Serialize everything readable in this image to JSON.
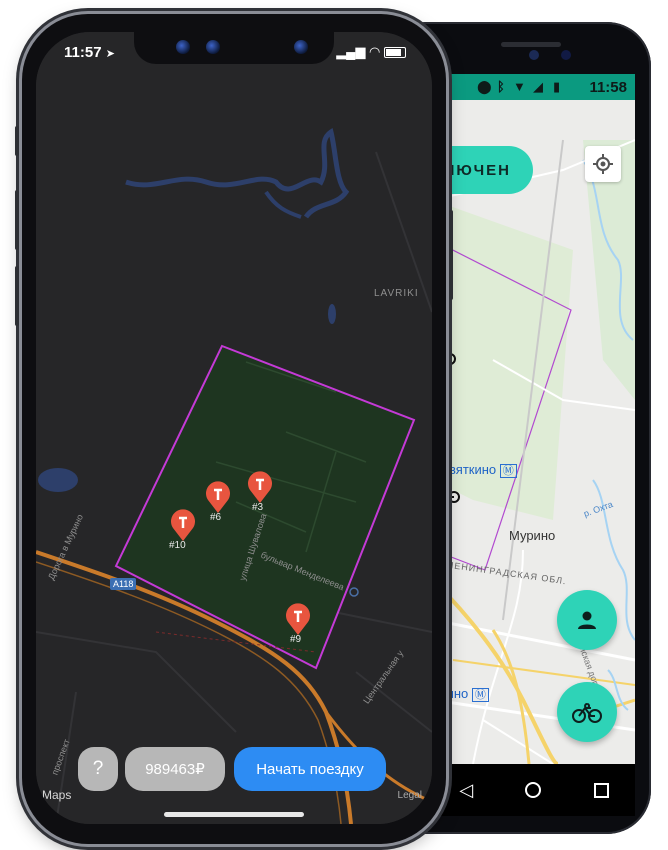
{
  "android": {
    "status": {
      "time": "11:58"
    },
    "status_pill": {
      "label": "КЛЮЧЕН"
    },
    "map_labels": {
      "devyatkino": "Девяткино",
      "murino": "Мурино",
      "murino_station": "урино",
      "leningradskaya": "ЛЕНИНГРАДСКАЯ ОБЛ.",
      "okhta": "р. Охта",
      "muriskaya": "Мурийская дор."
    },
    "fabs": [
      "person-icon",
      "bike-icon"
    ],
    "nav": [
      "back-icon",
      "home-icon",
      "recents-icon"
    ]
  },
  "iphone": {
    "status": {
      "time": "11:57"
    },
    "map_labels": {
      "lavriki": "LAVRIKI",
      "road_a118": "A118",
      "doroga": "Дорога в Мурино",
      "shuvalova": "улица Шувалова",
      "mendeleeva": "бульвар Менделеева",
      "centralnaya": "Центральная у",
      "prospekt": "проспект"
    },
    "pins": [
      {
        "label": "#10"
      },
      {
        "label": "#6"
      },
      {
        "label": "#3"
      },
      {
        "label": "#9"
      }
    ],
    "buttons": {
      "help": "?",
      "balance": "989463₽",
      "start": "Начать поездку"
    },
    "maps_brand": "Maps",
    "legal": "Legal"
  },
  "colors": {
    "teal": "#2ed3b7",
    "status_green": "#0b9a80",
    "ios_blue": "#2d8cf3",
    "zone_outline": "#c43ad6",
    "pin_red": "#e8553f"
  }
}
